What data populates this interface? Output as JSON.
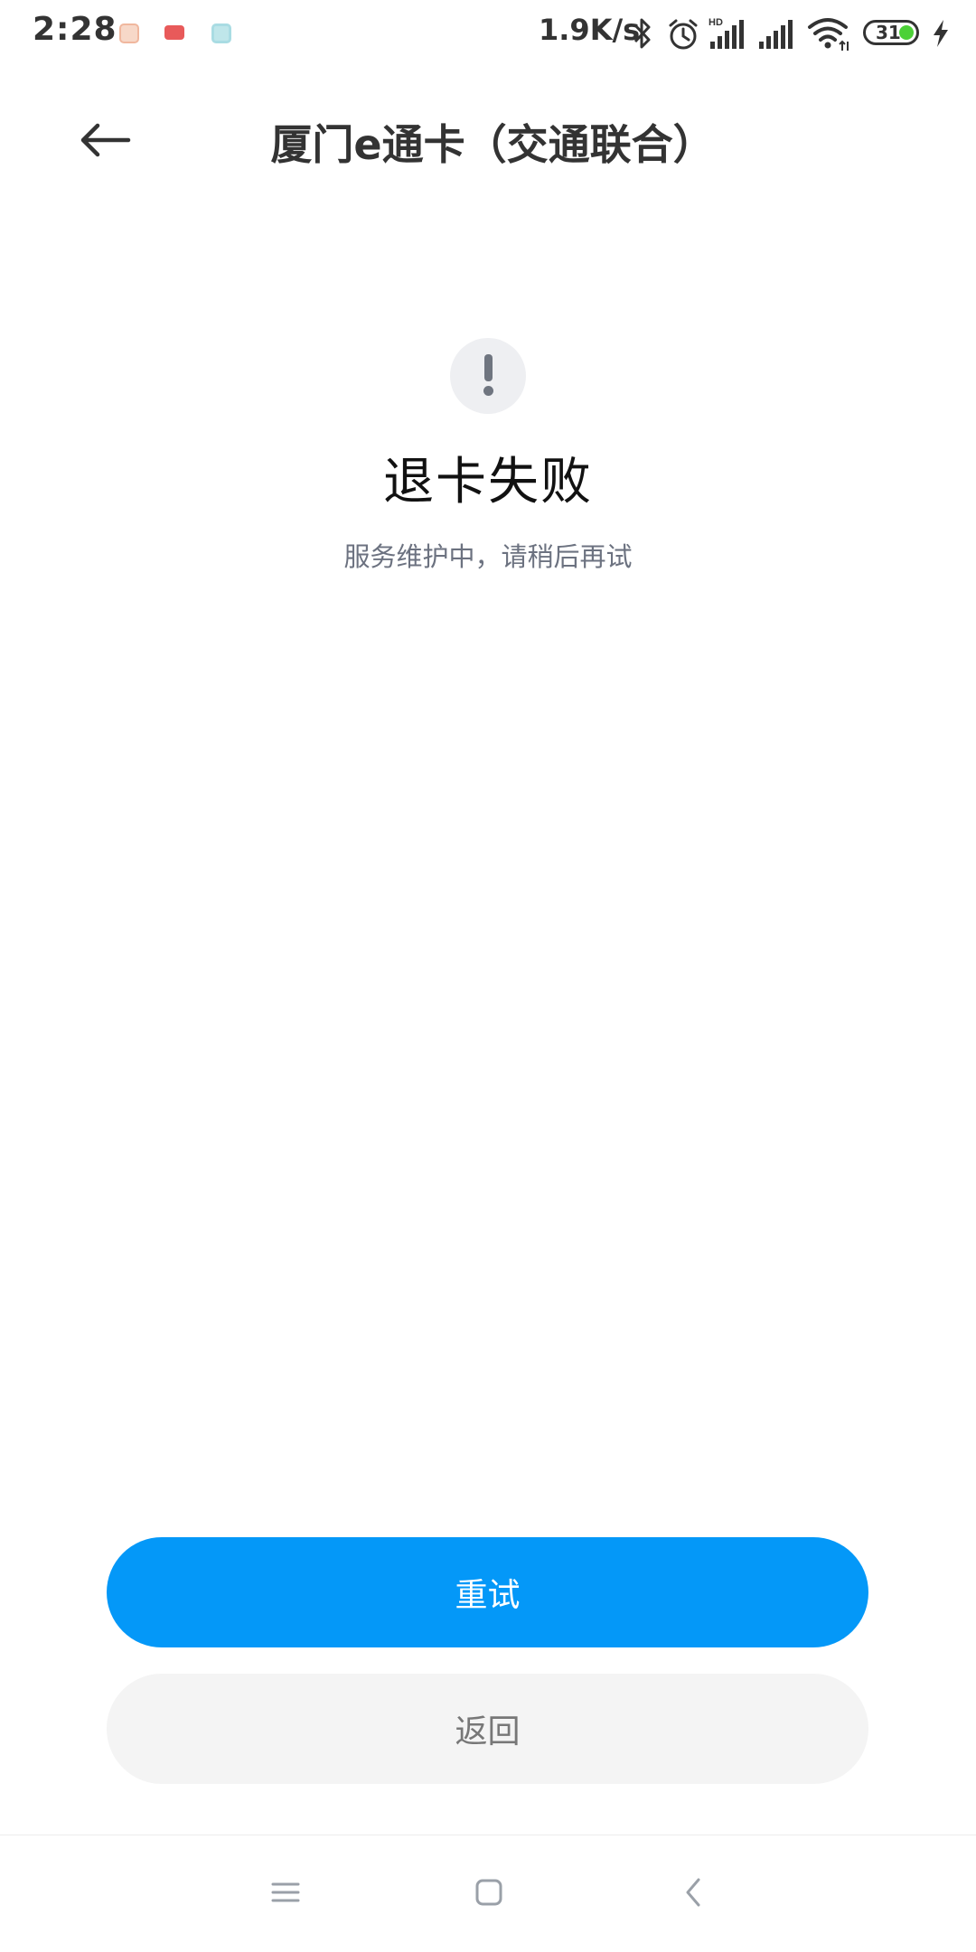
{
  "status_bar": {
    "time": "2:28",
    "net_speed": "1.9K/s",
    "battery": "31",
    "notifications": [
      "app-notification-icon",
      "message-notification-icon",
      "app-notification-icon"
    ],
    "icons": [
      "bluetooth-icon",
      "alarm-icon",
      "signal-hd-icon",
      "signal-icon",
      "wifi-icon",
      "battery-icon",
      "charging-icon"
    ]
  },
  "header": {
    "title": "厦门e通卡（交通联合）",
    "back_icon": "arrow-left-icon"
  },
  "result": {
    "icon": "alert-icon",
    "title": "退卡失败",
    "description": "服务维护中，请稍后再试"
  },
  "actions": {
    "retry_label": "重试",
    "back_label": "返回"
  },
  "nav_bar": {
    "icons": [
      "menu-icon",
      "home-icon",
      "back-icon"
    ]
  },
  "colors": {
    "primary": "#0498f8",
    "secondary_bg": "#f4f4f4",
    "alert_bg": "#eeeff2",
    "alert_fg": "#6f7580",
    "battery_level": "#4cd137"
  }
}
